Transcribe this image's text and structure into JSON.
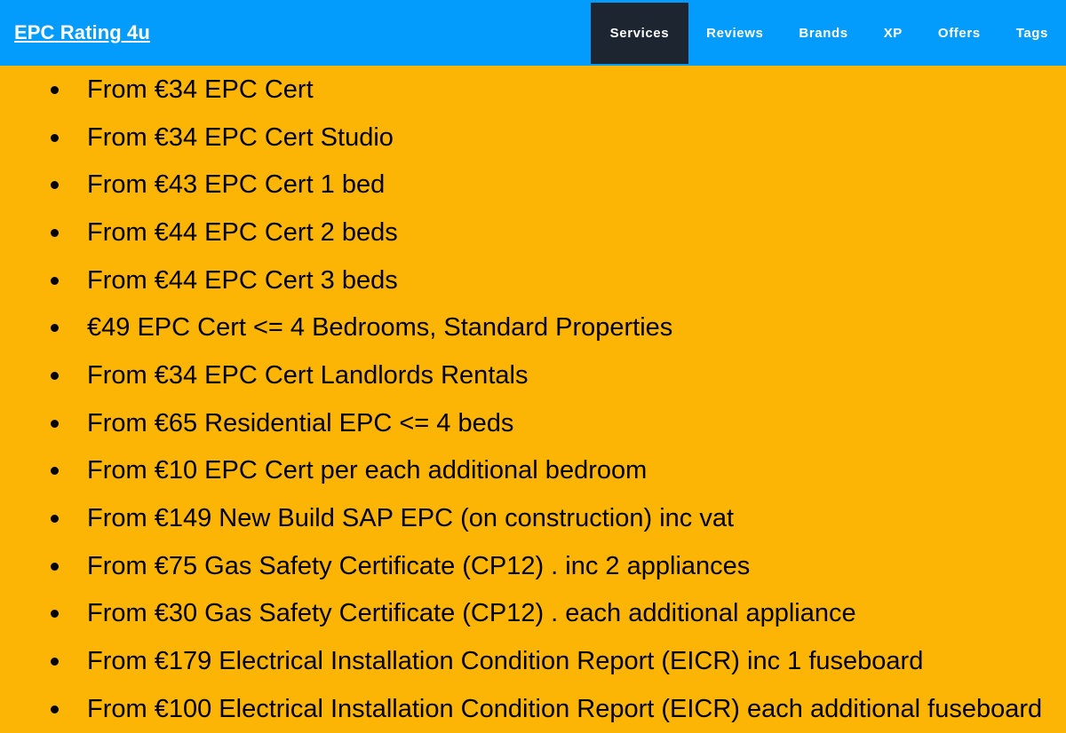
{
  "header": {
    "brand": "EPC Rating 4u",
    "background_color": "#039bfc",
    "text_color": "#ffffff",
    "active_tab_color": "#1d2530",
    "nav": [
      {
        "label": "Services",
        "active": true
      },
      {
        "label": "Reviews",
        "active": false
      },
      {
        "label": "Brands",
        "active": false
      },
      {
        "label": "XP",
        "active": false
      },
      {
        "label": "Offers",
        "active": false
      },
      {
        "label": "Tags",
        "active": false
      }
    ]
  },
  "content": {
    "background_color": "#fcb505",
    "text_color": "#000000",
    "services": [
      {
        "text": "From €34 EPC Cert"
      },
      {
        "text": "From €34 EPC Cert Studio"
      },
      {
        "text": "From €43 EPC Cert 1 bed"
      },
      {
        "text": "From €44 EPC Cert 2 beds"
      },
      {
        "text": "From €44 EPC Cert 3 beds"
      },
      {
        "text": "€49 EPC Cert <= 4 Bedrooms, Standard Properties"
      },
      {
        "text": "From €34 EPC Cert Landlords Rentals"
      },
      {
        "text": "From €65 Residential EPC <= 4 beds"
      },
      {
        "text": "From €10 EPC Cert per each additional bedroom"
      },
      {
        "text": "From €149 New Build SAP EPC (on construction) inc vat"
      },
      {
        "text": "From €75 Gas Safety Certificate (CP12) . inc 2 appliances"
      },
      {
        "text": "From €30 Gas Safety Certificate (CP12) . each additional appliance"
      },
      {
        "text": "From €179 Electrical Installation Condition Report (EICR) inc 1 fuseboard"
      },
      {
        "text": "From €100 Electrical Installation Condition Report (EICR) each additional fuseboard"
      }
    ]
  }
}
